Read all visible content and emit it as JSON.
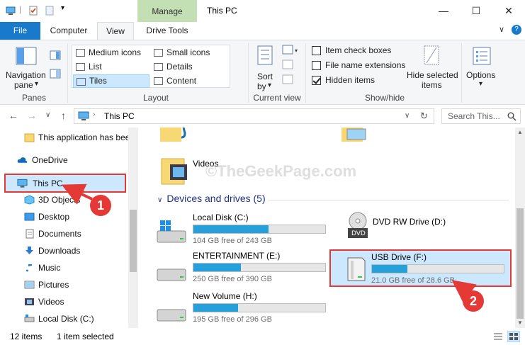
{
  "titlebar": {
    "manage_label": "Manage",
    "title": "This PC",
    "minimize": "—",
    "maximize": "☐",
    "close": "✕"
  },
  "tabs": {
    "file": "File",
    "computer": "Computer",
    "view": "View",
    "drive_tools": "Drive Tools",
    "collapse": "∨",
    "help": "?"
  },
  "ribbon": {
    "panes": {
      "nav_pane_line1": "Navigation",
      "nav_pane_line2": "pane",
      "dropdown": "▾",
      "group": "Panes"
    },
    "layout": {
      "medium_icons": "Medium icons",
      "small_icons": "Small icons",
      "list": "List",
      "details": "Details",
      "tiles": "Tiles",
      "content": "Content",
      "group": "Layout"
    },
    "current_view": {
      "sort_line1": "Sort",
      "sort_line2": "by",
      "dropdown": "▾",
      "group": "Current view"
    },
    "show_hide": {
      "item_check_boxes": "Item check boxes",
      "file_name_extensions": "File name extensions",
      "hidden_items": "Hidden items",
      "hide_selected_line1": "Hide selected",
      "hide_selected_line2": "items",
      "group": "Show/hide"
    },
    "options": {
      "label": "Options",
      "dropdown": "▾"
    }
  },
  "address": {
    "back": "←",
    "forward": "→",
    "recent": "∨",
    "up": "↑",
    "path": "This PC",
    "dropdown": "∨",
    "refresh": "↻",
    "search_placeholder": "Search This..."
  },
  "navpane": {
    "items": [
      {
        "label": "This application has bee"
      },
      {
        "label": "OneDrive"
      },
      {
        "label": "This PC"
      },
      {
        "label": "3D Objects"
      },
      {
        "label": "Desktop"
      },
      {
        "label": "Documents"
      },
      {
        "label": "Downloads"
      },
      {
        "label": "Music"
      },
      {
        "label": "Pictures"
      },
      {
        "label": "Videos"
      },
      {
        "label": "Local Disk (C:)"
      }
    ]
  },
  "content": {
    "videos_label": "Videos",
    "section_header": "Devices and drives (5)",
    "watermark": "©TheGeekPage.com",
    "drives": [
      {
        "name": "Local Disk (C:)",
        "free": "104 GB free of 243 GB",
        "used_fraction": 0.57
      },
      {
        "name": "DVD RW Drive (D:)",
        "free": "",
        "used_fraction": null
      },
      {
        "name": "ENTERTAINMENT (E:)",
        "free": "250 GB free of 390 GB",
        "used_fraction": 0.36
      },
      {
        "name": "USB Drive (F:)",
        "free": "21.0 GB free of 28.6 GB",
        "used_fraction": 0.27
      },
      {
        "name": "New Volume (H:)",
        "free": "195 GB free of 296 GB",
        "used_fraction": 0.34
      }
    ],
    "dvd_badge": "DVD"
  },
  "statusbar": {
    "items_count": "12 items",
    "selected": "1 item selected"
  },
  "annotations": {
    "step1": "1",
    "step2": "2"
  },
  "colors": {
    "accent": "#1979ca",
    "selection": "#cce8ff",
    "highlight_box": "#e53935",
    "drive_bar": "#26a0da",
    "manage_tab": "#c3dfb4"
  }
}
